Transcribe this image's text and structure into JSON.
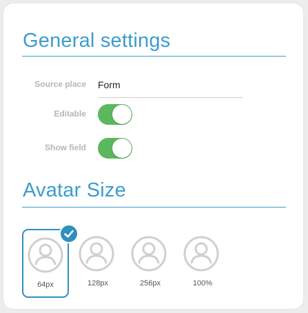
{
  "general": {
    "title": "General settings",
    "source_place_label": "Source place",
    "source_place_value": "Form",
    "editable_label": "Editable",
    "editable_on": true,
    "show_field_label": "Show field",
    "show_field_on": true
  },
  "avatar": {
    "title": "Avatar Size",
    "options": [
      {
        "label": "64px",
        "selected": true
      },
      {
        "label": "128px",
        "selected": false
      },
      {
        "label": "256px",
        "selected": false
      },
      {
        "label": "100%",
        "selected": false
      }
    ]
  },
  "colors": {
    "accent": "#3d9ccc",
    "toggle_on": "#5cb85c",
    "selected_border": "#2f8fbf",
    "avatar_gray": "#cfcfcf"
  },
  "icons": {
    "avatar": "user-avatar-icon",
    "selected": "checkmark-icon"
  }
}
